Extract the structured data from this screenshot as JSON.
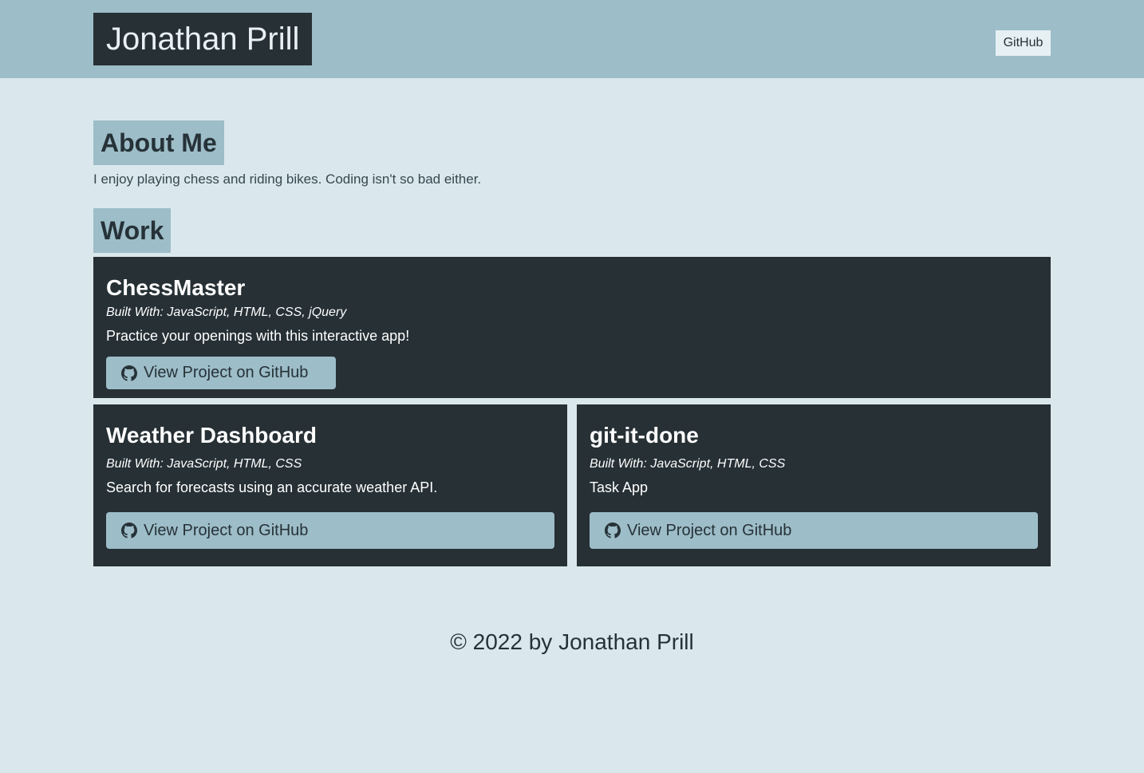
{
  "header": {
    "brand": "Jonathan Prill",
    "nav_link": "GitHub"
  },
  "about": {
    "title": "About Me",
    "text": "I enjoy playing chess and riding bikes. Coding isn't so bad either."
  },
  "work": {
    "title": "Work",
    "projects": [
      {
        "title": "ChessMaster",
        "built_with": "Built With: JavaScript, HTML, CSS, jQuery",
        "description": "Practice your openings with this interactive app!",
        "button": "View Project on GitHub",
        "button_icon": "github-icon"
      },
      {
        "title": "Weather Dashboard",
        "built_with": "Built With: JavaScript, HTML, CSS",
        "description": "Search for forecasts using an accurate weather API.",
        "button": "View Project on GitHub",
        "button_icon": "github-icon"
      },
      {
        "title": "git-it-done",
        "built_with": "Built With: JavaScript, HTML, CSS",
        "description": "Task App",
        "button": "View Project on GitHub",
        "button_icon": "github-icon"
      }
    ]
  },
  "footer": {
    "text": "© 2022 by Jonathan Prill"
  },
  "colors": {
    "page_bg": "#dae8ed",
    "accent": "#9dbdc8",
    "dark": "#263035"
  }
}
